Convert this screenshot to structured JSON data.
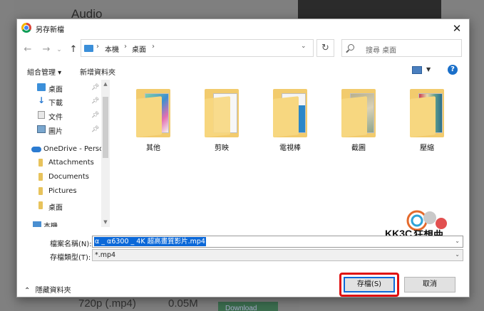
{
  "background": {
    "title": "Audio",
    "resolution": "720p (.mp4)",
    "size": "0.05M",
    "download_label": "Download"
  },
  "dialog": {
    "title": "另存新檔",
    "close_glyph": "✕"
  },
  "address": {
    "crumbs": [
      "本機",
      "桌面"
    ],
    "search_placeholder": "搜尋 桌面"
  },
  "toolbar": {
    "organize": "組合管理 ▾",
    "new_folder": "新增資料夾",
    "help": "?"
  },
  "nav": {
    "items": [
      {
        "label": "桌面",
        "icon": "desktop-icon",
        "pinned": true
      },
      {
        "label": "下載",
        "icon": "download-icon",
        "pinned": true
      },
      {
        "label": "文件",
        "icon": "documents-icon",
        "pinned": true
      },
      {
        "label": "圖片",
        "icon": "pictures-icon",
        "pinned": true
      },
      {
        "label": "OneDrive - Perso",
        "icon": "onedrive-icon",
        "pinned": false
      },
      {
        "label": "Attachments",
        "icon": "folder-icon",
        "pinned": false
      },
      {
        "label": "Documents",
        "icon": "folder-icon",
        "pinned": false
      },
      {
        "label": "Pictures",
        "icon": "folder-icon",
        "pinned": false
      },
      {
        "label": "桌面",
        "icon": "folder-icon",
        "pinned": false
      },
      {
        "label": "本機",
        "icon": "pc-icon",
        "pinned": false
      }
    ]
  },
  "folders": [
    {
      "name": "其他"
    },
    {
      "name": "剪映"
    },
    {
      "name": "電視棒"
    },
    {
      "name": "截圖"
    },
    {
      "name": "壓縮"
    }
  ],
  "watermark": {
    "text": "KK3C",
    "subtext": "狂想曲"
  },
  "fields": {
    "filename_label": "檔案名稱(N):",
    "filename_value": "α _ α6300 _ 4K 超高畫質影片.mp4",
    "filetype_label": "存檔類型(T):",
    "filetype_value": "*.mp4"
  },
  "footer": {
    "hide_folders": "隱藏資料夾",
    "save": "存檔(S)",
    "cancel": "取消"
  },
  "colors": {
    "accent": "#0b68d8",
    "highlight": "#e01010",
    "folder": "#f2cb6d"
  }
}
